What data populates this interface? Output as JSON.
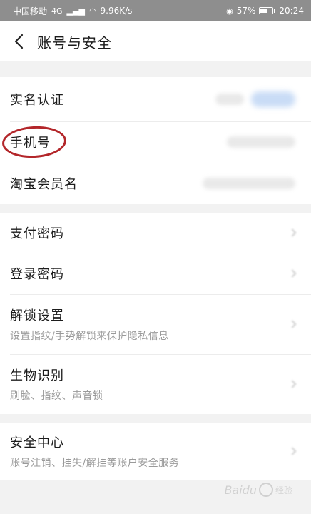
{
  "status_bar": {
    "carrier": "中国移动",
    "network": "4G",
    "speed": "9.96K/s",
    "battery": "57%",
    "time": "20:24"
  },
  "nav": {
    "back_icon": "chevron-left-icon",
    "title": "账号与安全"
  },
  "groups": [
    {
      "items": [
        {
          "title": "实名认证"
        },
        {
          "title": "手机号"
        },
        {
          "title": "淘宝会员名"
        }
      ]
    },
    {
      "items": [
        {
          "title": "支付密码"
        },
        {
          "title": "登录密码"
        },
        {
          "title": "解锁设置",
          "subtitle": "设置指纹/手势解锁来保护隐私信息"
        },
        {
          "title": "生物识别",
          "subtitle": "刷脸、指纹、声音锁"
        }
      ]
    },
    {
      "items": [
        {
          "title": "安全中心",
          "subtitle": "账号注销、挂失/解挂等账户安全服务"
        }
      ]
    }
  ],
  "annotation": {
    "color": "#b3262a"
  },
  "watermark": {
    "brand": "Baidu",
    "sub": "经验"
  },
  "colors": {
    "status_bar_bg": "#8e8e8e",
    "page_bg": "#f2f2f2",
    "highlight": "#b3262a"
  }
}
